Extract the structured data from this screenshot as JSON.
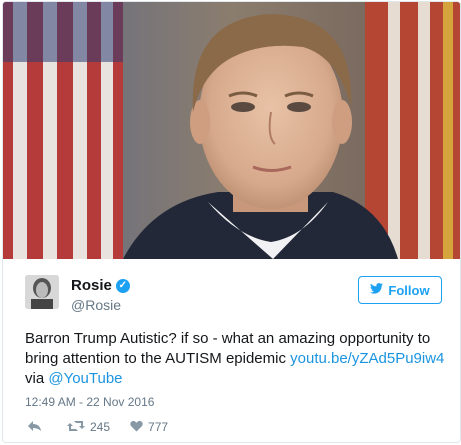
{
  "user": {
    "name": "Rosie",
    "handle": "@Rosie",
    "verified_mark": "✓"
  },
  "follow_button": {
    "icon": "twitter-bird-icon",
    "label": "Follow"
  },
  "tweet": {
    "text_before_link": "Barron Trump Autistic? if so - what an amazing opportunity to bring attention to the AUTISM epidemic ",
    "link": "youtu.be/yZAd5Pu9iw4",
    "via": "via ",
    "mention": "@YouTube",
    "timestamp": "12:49 AM - 22 Nov 2016"
  },
  "actions": {
    "reply_icon": "reply-icon",
    "retweet_icon": "retweet-icon",
    "retweet_count": "245",
    "like_icon": "heart-icon",
    "like_count": "777"
  },
  "colors": {
    "accent": "#1da1f2",
    "link": "#1b95e0",
    "muted": "#657786"
  }
}
